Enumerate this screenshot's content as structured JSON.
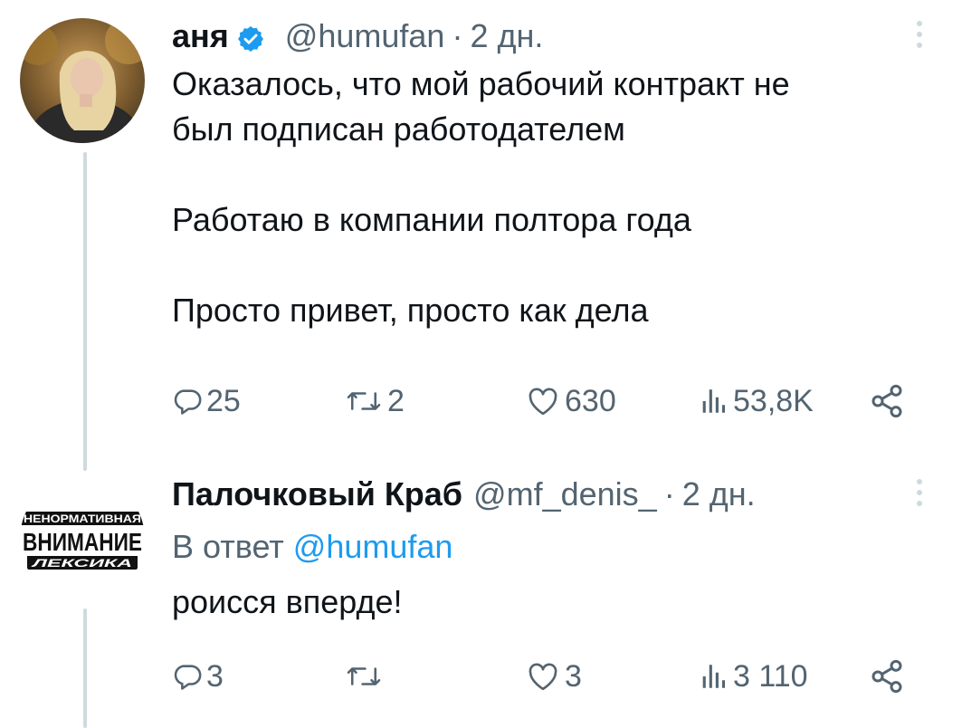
{
  "tweets": [
    {
      "author": {
        "name": "аня",
        "handle": "@humufan",
        "verified": true
      },
      "time": "2 дн.",
      "text": "Оказалось, что мой рабочий контракт не\nбыл подписан работодателем\n\nРаботаю в компании полтора года\n\nПросто привет, просто как дела",
      "stats": {
        "replies": "25",
        "retweets": "2",
        "likes": "630",
        "views": "53,8K"
      }
    },
    {
      "author": {
        "name": "Палочковый Краб",
        "handle": "@mf_denis_",
        "avatar_text": [
          "НЕНОРМАТИВНАЯ",
          "ВНИМАНИЕ",
          "ЛЕКСИКА"
        ]
      },
      "time": "2 дн.",
      "reply_prefix": "В ответ",
      "reply_to": "@humufan",
      "text": "роисся вперде!",
      "stats": {
        "replies": "3",
        "retweets": "",
        "likes": "3",
        "views": "3 110"
      }
    }
  ],
  "separator": "·",
  "colors": {
    "text": "#0f1419",
    "secondary": "#536471",
    "accent": "#1d9bf0",
    "thread_line": "#cfd9de"
  },
  "icons": [
    "verified-badge-icon",
    "more-icon",
    "reply-icon",
    "retweet-icon",
    "like-icon",
    "views-icon",
    "share-icon"
  ]
}
